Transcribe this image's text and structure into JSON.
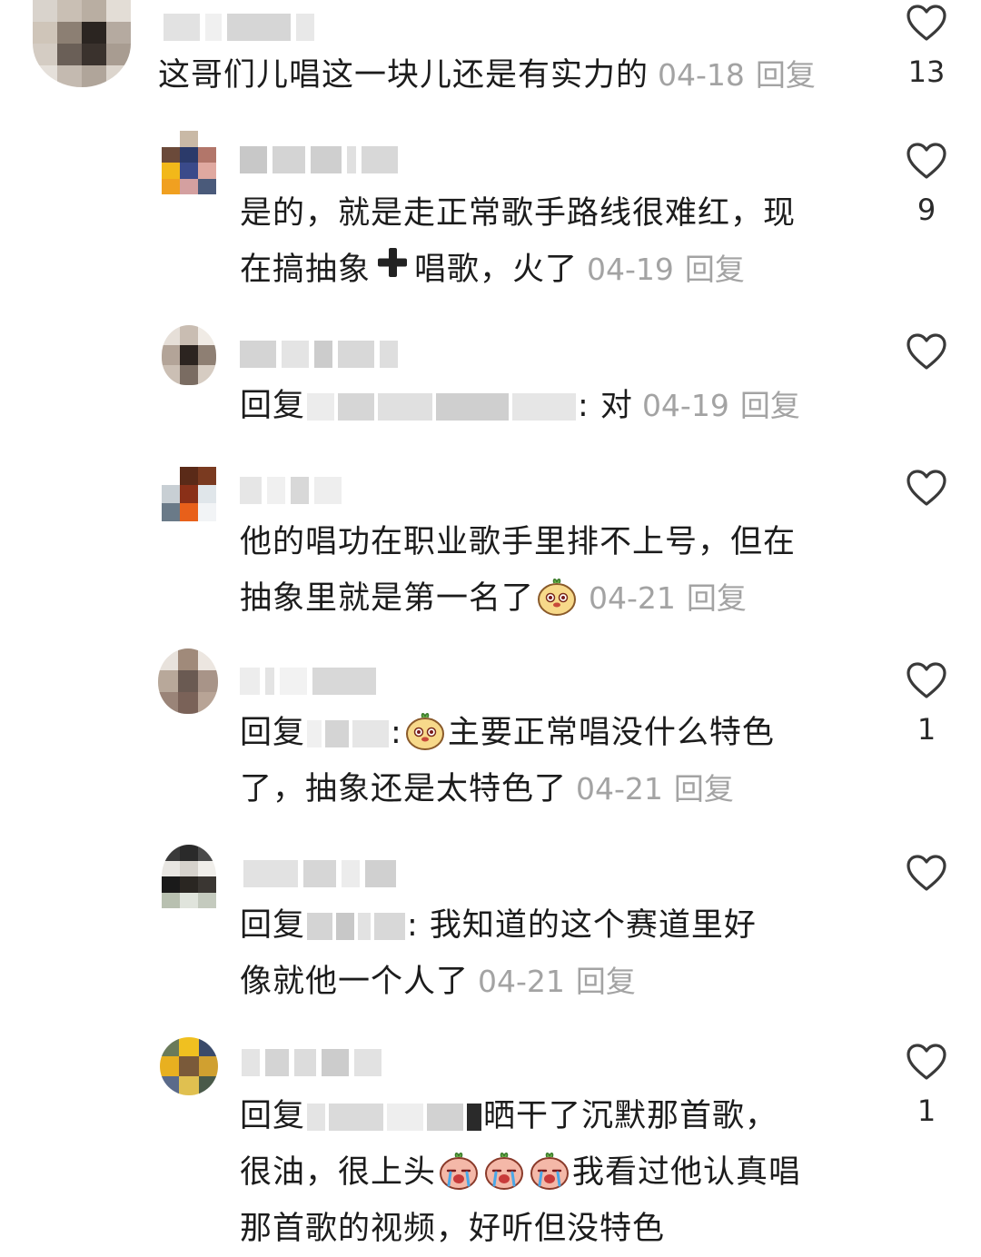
{
  "comments": [
    {
      "text": "这哥们儿唱这一块儿还是有实力的",
      "date": "04-18",
      "reply": "回复",
      "likes": "13"
    },
    {
      "line1": "是的，就是走正常歌手路线很难红，现",
      "line2a": "在搞抽象",
      "line2b": "唱歌，火了",
      "date": "04-19",
      "reply": "回复",
      "likes": "9"
    },
    {
      "prefix": "回复",
      "suffix": ": 对",
      "date": "04-19",
      "reply": "回复",
      "likes": ""
    },
    {
      "line1": "他的唱功在职业歌手里排不上号，但在",
      "line2": "抽象里就是第一名了",
      "date": "04-21",
      "reply": "回复",
      "likes": ""
    },
    {
      "prefix": "回复",
      "line1": "主要正常唱没什么特色",
      "line2": "了，抽象还是太特色了",
      "date": "04-21",
      "reply": "回复",
      "likes": "1"
    },
    {
      "prefix": "回复",
      "line1": ": 我知道的这个赛道里好",
      "line2": "像就他一个人了",
      "date": "04-21",
      "reply": "回复",
      "likes": ""
    },
    {
      "prefix": "回复",
      "line1": "晒干了沉默那首歌，",
      "line2a": "很油，很上头",
      "line2b": "我看过他认真唱",
      "line3": "那首歌的视频，好听但没特色",
      "likes": "1"
    }
  ],
  "icons": {
    "like": "heart-outline-icon",
    "plus": "plus-emoji-icon",
    "emoji": "sticker-emoji-icon"
  },
  "colors": {
    "meta": "#a3a3a3",
    "text": "#1c1c1c",
    "icon": "#3a3a3a"
  }
}
